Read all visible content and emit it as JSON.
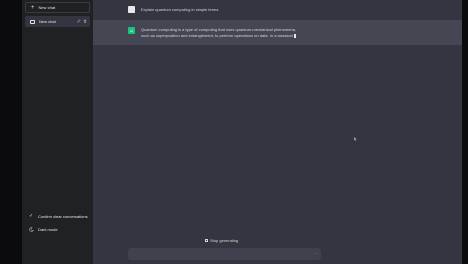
{
  "sidebar": {
    "new_chat_label": "New chat",
    "chats": [
      {
        "label": "New chat"
      }
    ],
    "bottom_items": [
      {
        "label": "Confirm clear conversations",
        "icon": "check-icon"
      },
      {
        "label": "Dark mode",
        "icon": "moon-icon"
      }
    ]
  },
  "conversation": {
    "user_message": "Explain quantum computing in simple terms",
    "ai_avatar": "AI",
    "ai_message_line1": "Quantum computing is a type of computing that uses quantum-mechanical phenomena,",
    "ai_message_line2": "such as superposition and entanglement, to perform operations on data. In a classical"
  },
  "composer": {
    "stop_label": "Stop generating",
    "input_value": "",
    "input_placeholder": ""
  },
  "colors": {
    "sidebar_bg": "#202123",
    "main_bg": "#343541",
    "ai_row_bg": "#444654",
    "ai_avatar_bg": "#19c37d",
    "input_bg": "#40414f"
  }
}
